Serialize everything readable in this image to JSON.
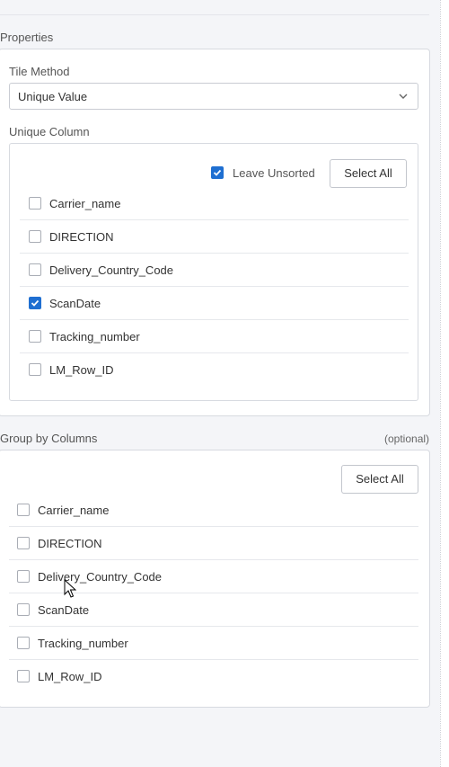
{
  "properties": {
    "title": "Properties",
    "tile_method": {
      "label": "Tile Method",
      "value": "Unique Value"
    },
    "unique_column": {
      "label": "Unique Column",
      "leave_unsorted_label": "Leave Unsorted",
      "leave_unsorted_checked": true,
      "select_all_label": "Select All",
      "items": [
        {
          "label": "Carrier_name",
          "checked": false
        },
        {
          "label": "DIRECTION",
          "checked": false
        },
        {
          "label": "Delivery_Country_Code",
          "checked": false
        },
        {
          "label": "ScanDate",
          "checked": true
        },
        {
          "label": "Tracking_number",
          "checked": false
        },
        {
          "label": "LM_Row_ID",
          "checked": false
        }
      ]
    }
  },
  "group_by": {
    "title": "Group by Columns",
    "optional": "(optional)",
    "select_all_label": "Select All",
    "items": [
      {
        "label": "Carrier_name",
        "checked": false
      },
      {
        "label": "DIRECTION",
        "checked": false
      },
      {
        "label": "Delivery_Country_Code",
        "checked": false
      },
      {
        "label": "ScanDate",
        "checked": false
      },
      {
        "label": "Tracking_number",
        "checked": false
      },
      {
        "label": "LM_Row_ID",
        "checked": false
      }
    ]
  },
  "colors": {
    "accent": "#1f6fd1",
    "border": "#d7dae0",
    "background": "#f4f5f8"
  }
}
